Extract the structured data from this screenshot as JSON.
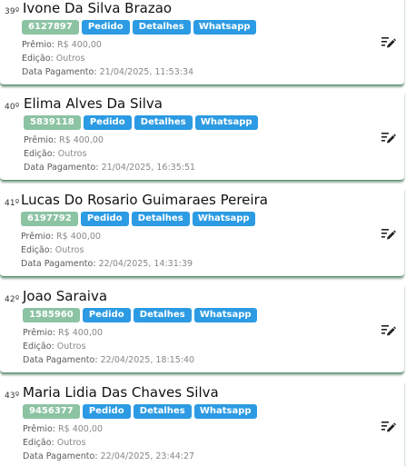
{
  "labels": {
    "premio": "Prêmio:",
    "edicao": "Edição:",
    "data_pagamento": "Data Pagamento:",
    "pedido": "Pedido",
    "detalhes": "Detalhes",
    "whatsapp": "Whatsapp"
  },
  "colors": {
    "code_badge": "#8cc3a3",
    "action_button": "#2c9be3",
    "card_bottom_border": "#5a8f6e"
  },
  "entries": [
    {
      "rank": "39º",
      "name": "Ivone Da Silva Brazao",
      "code": "6127897",
      "premio": "R$ 400,00",
      "edicao": "Outros",
      "data_pagamento": "21/04/2025, 11:53:34",
      "edit_icon": "edit-pencil-icon"
    },
    {
      "rank": "40º",
      "name": "Elima Alves Da Silva",
      "code": "5839118",
      "premio": "R$ 400,00",
      "edicao": "Outros",
      "data_pagamento": "21/04/2025, 16:35:51",
      "edit_icon": "edit-pencil-icon"
    },
    {
      "rank": "41º",
      "name": "Lucas Do Rosario Guimaraes Pereira",
      "code": "6197792",
      "premio": "R$ 400,00",
      "edicao": "Outros",
      "data_pagamento": "22/04/2025, 14:31:39",
      "edit_icon": "edit-pencil-icon"
    },
    {
      "rank": "42º",
      "name": "Joao Saraiva",
      "code": "1585960",
      "premio": "R$ 400,00",
      "edicao": "Outros",
      "data_pagamento": "22/04/2025, 18:15:40",
      "edit_icon": "edit-pencil-icon"
    },
    {
      "rank": "43º",
      "name": "Maria Lidia Das Chaves Silva",
      "code": "9456377",
      "premio": "R$ 400,00",
      "edicao": "Outros",
      "data_pagamento": "22/04/2025, 23:44:27",
      "edit_icon": "edit-pencil-icon"
    }
  ]
}
